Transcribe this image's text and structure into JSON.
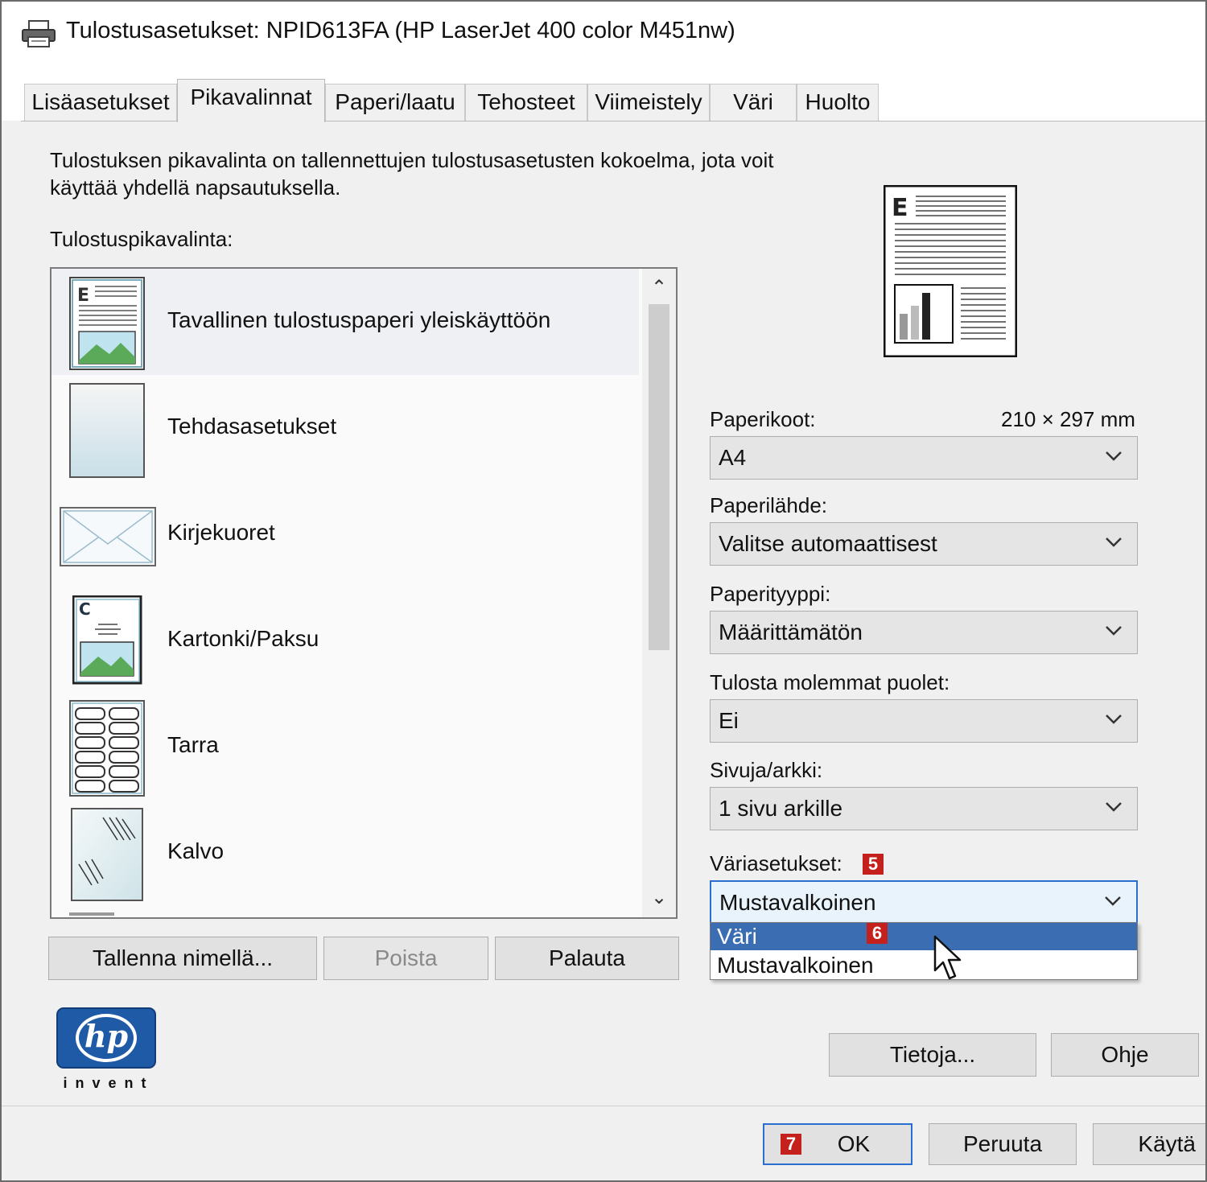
{
  "window": {
    "title": "Tulostusasetukset: NPID613FA (HP LaserJet 400 color M451nw)"
  },
  "tabs": [
    "Lisäasetukset",
    "Pikavalinnat",
    "Paperi/laatu",
    "Tehosteet",
    "Viimeistely",
    "Väri",
    "Huolto"
  ],
  "active_tab": "Pikavalinnat",
  "description": {
    "line1": "Tulostuksen pikavalinta on tallennettujen tulostusasetusten kokoelma, jota voit",
    "line2": "käyttää yhdellä napsautuksella."
  },
  "shortcuts": {
    "label": "Tulostuspikavalinta:",
    "items": [
      {
        "label": "Tavallinen tulostuspaperi yleiskäyttöön",
        "icon": "document-image-icon",
        "selected": true
      },
      {
        "label": "Tehdasasetukset",
        "icon": "blank-page-icon"
      },
      {
        "label": "Kirjekuoret",
        "icon": "envelope-icon"
      },
      {
        "label": "Kartonki/Paksu",
        "icon": "cardstock-icon"
      },
      {
        "label": "Tarra",
        "icon": "labels-icon"
      },
      {
        "label": "Kalvo",
        "icon": "transparency-icon"
      }
    ]
  },
  "list_buttons": {
    "save_as": "Tallenna nimellä...",
    "delete": "Poista",
    "reset": "Palauta"
  },
  "settings": {
    "paper_size": {
      "label": "Paperikoot:",
      "dims": "210 × 297 mm",
      "value": "A4"
    },
    "paper_source": {
      "label": "Paperilähde:",
      "value": "Valitse automaattisest"
    },
    "paper_type": {
      "label": "Paperityyppi:",
      "value": "Määrittämätön"
    },
    "duplex": {
      "label": "Tulosta molemmat puolet:",
      "value": "Ei"
    },
    "pages_per_sheet": {
      "label": "Sivuja/arkki:",
      "value": "1 sivu arkille"
    },
    "color": {
      "label": "Väriasetukset:",
      "value": "Mustavalkoinen",
      "options": [
        "Väri",
        "Mustavalkoinen"
      ],
      "highlighted": "Väri"
    }
  },
  "callouts": {
    "five": "5",
    "six": "6",
    "seven": "7"
  },
  "logo": {
    "mark": "hp",
    "tagline": "invent"
  },
  "side_buttons": {
    "about": "Tietoja...",
    "help": "Ohje"
  },
  "footer_buttons": {
    "ok": "OK",
    "cancel": "Peruuta",
    "apply": "Käytä"
  },
  "colors": {
    "selection": "#3b6db3",
    "callout": "#c4201c",
    "hp_blue": "#1f5aa6"
  }
}
